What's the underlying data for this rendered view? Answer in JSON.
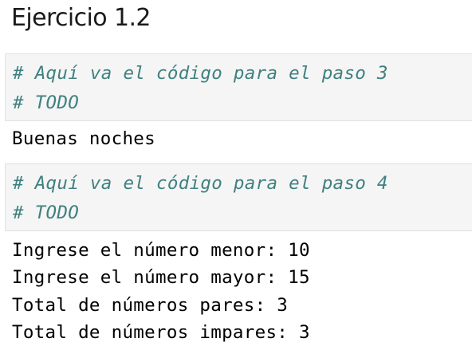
{
  "title": "Ejercicio 1.2",
  "cells": [
    {
      "code": [
        "# Aquí va el código para el paso 3",
        "# TODO"
      ],
      "output": [
        "Buenas noches"
      ]
    },
    {
      "code": [
        "# Aquí va el código para el paso 4",
        "# TODO"
      ],
      "output": [
        "Ingrese el número menor: 10",
        "Ingrese el número mayor: 15",
        "Total de números pares: 3",
        "Total de números impares: 3"
      ]
    }
  ],
  "colors": {
    "comment": "#408080",
    "cell_background": "#f5f5f5",
    "cell_border": "#e0e0e0",
    "output_text": "#000000"
  }
}
